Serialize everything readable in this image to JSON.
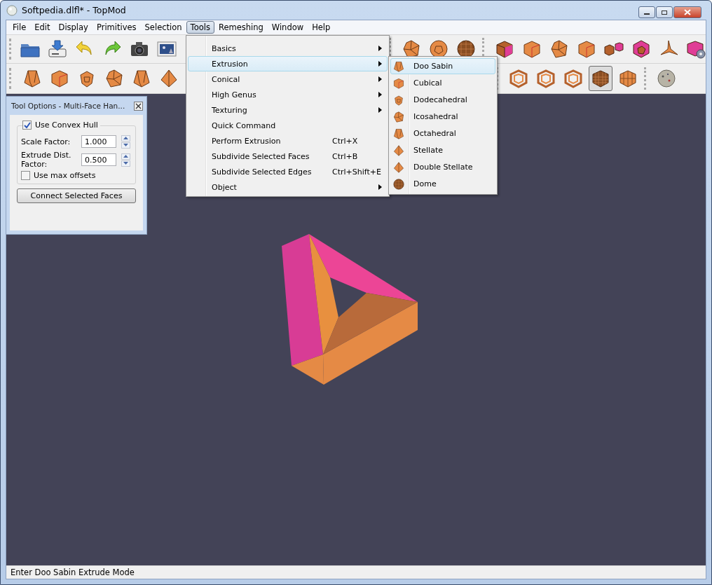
{
  "window": {
    "title": "Softpedia.dlfl* - TopMod"
  },
  "menu_bar": [
    {
      "label": "File",
      "selected": false
    },
    {
      "label": "Edit",
      "selected": false
    },
    {
      "label": "Display",
      "selected": false
    },
    {
      "label": "Primitives",
      "selected": false
    },
    {
      "label": "Selection",
      "selected": false
    },
    {
      "label": "Tools",
      "selected": true
    },
    {
      "label": "Remeshing",
      "selected": false
    },
    {
      "label": "Window",
      "selected": false
    },
    {
      "label": "Help",
      "selected": false
    }
  ],
  "toolbars": [
    {
      "groups": [
        [
          {
            "kind": "folder",
            "selected": false
          },
          {
            "kind": "save",
            "selected": false
          },
          {
            "kind": "undo",
            "selected": false
          },
          {
            "kind": "redo",
            "selected": false
          },
          {
            "kind": "camera",
            "selected": false
          },
          {
            "kind": "picture",
            "selected": false
          }
        ],
        [
          {
            "kind": "gem",
            "selected": false
          },
          {
            "kind": "ball",
            "selected": false
          },
          {
            "kind": "mesh-ball",
            "selected": false
          }
        ],
        [
          {
            "kind": "pink-cube",
            "selected": false
          },
          {
            "kind": "cube",
            "selected": false
          },
          {
            "kind": "gem",
            "selected": false
          },
          {
            "kind": "cube",
            "selected": false
          },
          {
            "kind": "cube-pair",
            "selected": false
          },
          {
            "kind": "pink-dodeca",
            "selected": false
          },
          {
            "kind": "tripod",
            "selected": false
          },
          {
            "kind": "gear-cube",
            "selected": false
          }
        ]
      ]
    },
    {
      "groups": [
        [
          {
            "kind": "frustum",
            "selected": false
          },
          {
            "kind": "cube",
            "selected": false
          },
          {
            "kind": "dodeca",
            "selected": false
          },
          {
            "kind": "gem",
            "selected": false
          },
          {
            "kind": "frustum",
            "selected": false
          },
          {
            "kind": "pyramid",
            "selected": false
          }
        ],
        [
          {
            "kind": "wire-cube",
            "selected": false
          },
          {
            "kind": "wire-cube",
            "selected": false
          },
          {
            "kind": "wire-cube",
            "selected": false
          },
          {
            "kind": "mesh-cube",
            "selected": true
          },
          {
            "kind": "grid-cube",
            "selected": false
          }
        ],
        [
          {
            "kind": "stone",
            "selected": false
          }
        ]
      ]
    }
  ],
  "tools_menu": [
    {
      "label": "Basics",
      "submenu": true,
      "selected": false
    },
    {
      "label": "Extrusion",
      "submenu": true,
      "selected": true
    },
    {
      "label": "Conical",
      "submenu": true,
      "selected": false
    },
    {
      "label": "High Genus",
      "submenu": true,
      "selected": false
    },
    {
      "label": "Texturing",
      "submenu": true,
      "selected": false
    },
    {
      "label": "Quick Command",
      "submenu": false,
      "selected": false
    },
    {
      "label": "Perform Extrusion",
      "shortcut": "Ctrl+X",
      "submenu": false,
      "selected": false
    },
    {
      "label": "Subdivide Selected Faces",
      "shortcut": "Ctrl+B",
      "submenu": false,
      "selected": false
    },
    {
      "label": "Subdivide Selected Edges",
      "shortcut": "Ctrl+Shift+E",
      "submenu": false,
      "selected": false
    },
    {
      "label": "Object",
      "submenu": true,
      "selected": false
    }
  ],
  "extrusion_submenu": [
    {
      "label": "Doo Sabin",
      "kind": "frustum",
      "selected": true
    },
    {
      "label": "Cubical",
      "kind": "cube",
      "selected": false
    },
    {
      "label": "Dodecahedral",
      "kind": "dodeca",
      "selected": false
    },
    {
      "label": "Icosahedral",
      "kind": "gem",
      "selected": false
    },
    {
      "label": "Octahedral",
      "kind": "frustum",
      "selected": false
    },
    {
      "label": "Stellate",
      "kind": "pyramid",
      "selected": false
    },
    {
      "label": "Double Stellate",
      "kind": "pyramid",
      "selected": false
    },
    {
      "label": "Dome",
      "kind": "mesh-ball",
      "selected": false
    }
  ],
  "tool_options": {
    "title": "Tool Options - Multi-Face Han...",
    "use_convex_hull": {
      "label": "Use Convex Hull",
      "checked": true
    },
    "fields": [
      {
        "label": "Scale Factor:",
        "value": "1.000"
      },
      {
        "label": "Extrude Dist. Factor:",
        "value": "0.500"
      }
    ],
    "use_max_offsets": {
      "label": "Use max offsets",
      "checked": false
    },
    "button": "Connect Selected Faces"
  },
  "status_bar": "Enter Doo Sabin Extrude Mode"
}
